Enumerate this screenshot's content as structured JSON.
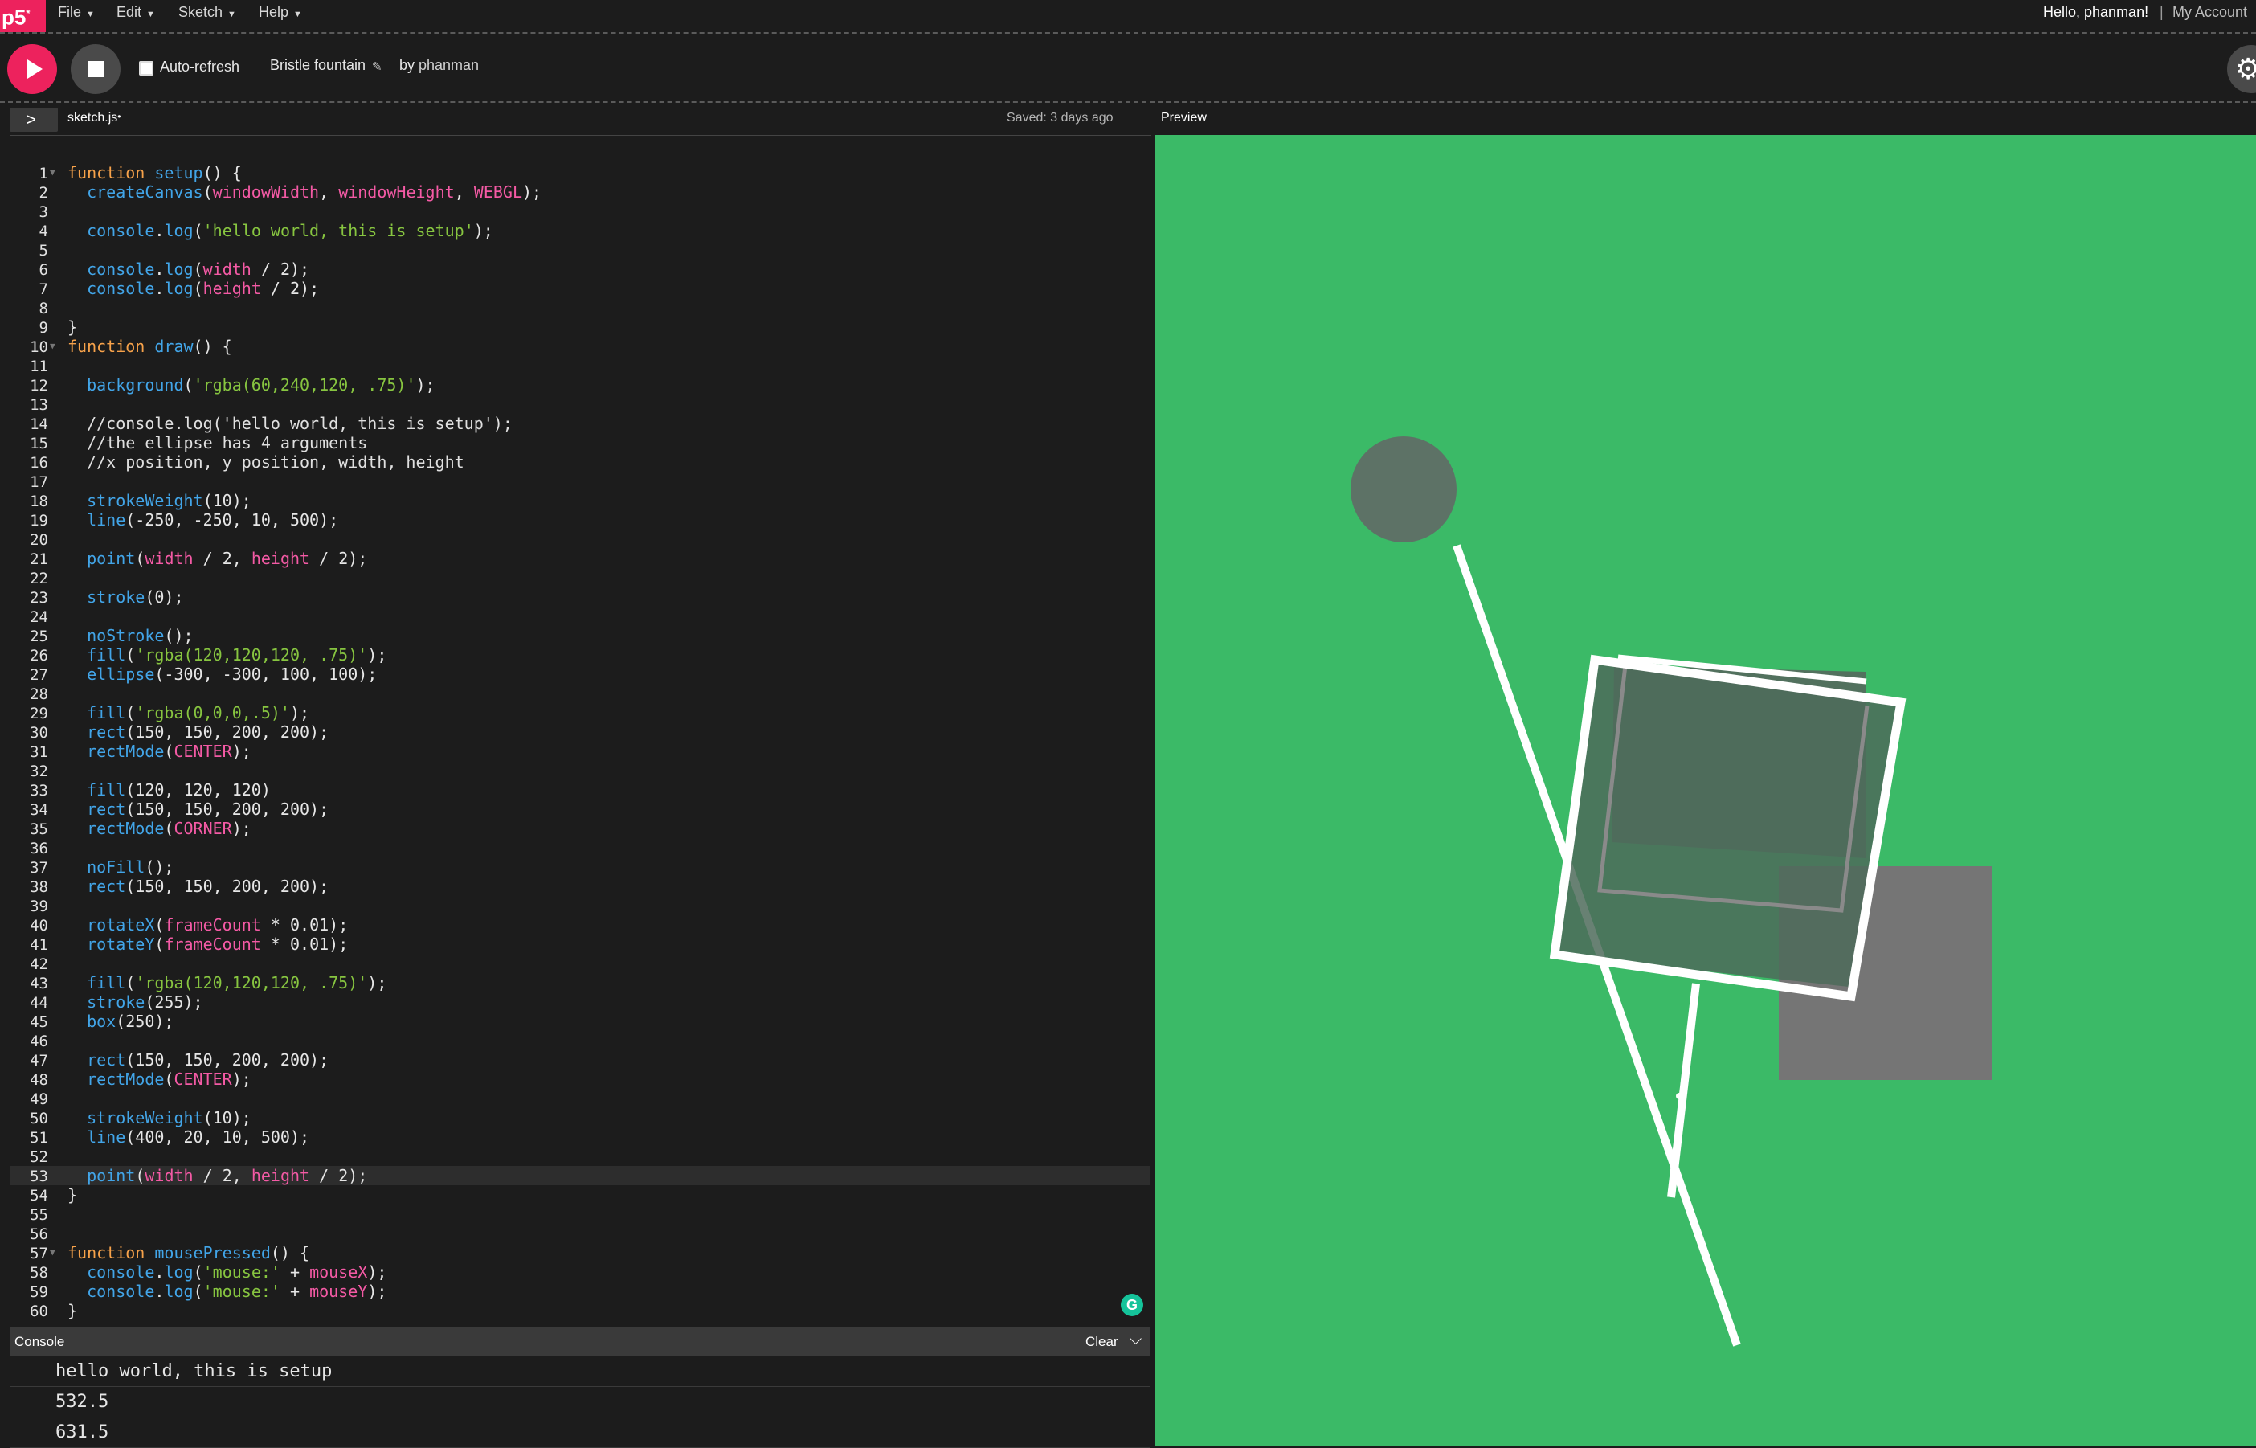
{
  "nav": {
    "logo": "p5",
    "logo_mark": "*",
    "menus": [
      {
        "label": "File"
      },
      {
        "label": "Edit"
      },
      {
        "label": "Sketch"
      },
      {
        "label": "Help"
      }
    ],
    "greeting": "Hello, phanman!",
    "separator": "|",
    "account": "My Account"
  },
  "toolbar": {
    "auto_refresh_label": "Auto-refresh",
    "auto_refresh_checked": false,
    "sketch_name": "Bristle fountain",
    "by_label": "by",
    "author": "phanman"
  },
  "editor": {
    "file_name": "sketch.js",
    "unsaved_mark": "•",
    "saved_status": "Saved: 3 days ago",
    "active_line": 53,
    "lines": [
      [],
      [
        [
          "k",
          "function "
        ],
        [
          "f",
          "setup"
        ],
        [
          "p",
          "() {"
        ]
      ],
      [
        [
          "p",
          "  "
        ],
        [
          "f",
          "createCanvas"
        ],
        [
          "p",
          "("
        ],
        [
          "v",
          "windowWidth"
        ],
        [
          "p",
          ", "
        ],
        [
          "v",
          "windowHeight"
        ],
        [
          "p",
          ", "
        ],
        [
          "v",
          "WEBGL"
        ],
        [
          "p",
          ");"
        ]
      ],
      [],
      [
        [
          "p",
          "  "
        ],
        [
          "f",
          "console"
        ],
        [
          "p",
          "."
        ],
        [
          "f",
          "log"
        ],
        [
          "p",
          "("
        ],
        [
          "s",
          "'hello world, this is setup'"
        ],
        [
          "p",
          ");"
        ]
      ],
      [],
      [
        [
          "p",
          "  "
        ],
        [
          "f",
          "console"
        ],
        [
          "p",
          "."
        ],
        [
          "f",
          "log"
        ],
        [
          "p",
          "("
        ],
        [
          "v",
          "width"
        ],
        [
          "p",
          " / 2);"
        ]
      ],
      [
        [
          "p",
          "  "
        ],
        [
          "f",
          "console"
        ],
        [
          "p",
          "."
        ],
        [
          "f",
          "log"
        ],
        [
          "p",
          "("
        ],
        [
          "v",
          "height"
        ],
        [
          "p",
          " / 2);"
        ]
      ],
      [],
      [
        [
          "p",
          "}"
        ]
      ],
      [
        [
          "k",
          "function "
        ],
        [
          "f",
          "draw"
        ],
        [
          "p",
          "() {"
        ]
      ],
      [],
      [
        [
          "p",
          "  "
        ],
        [
          "f",
          "background"
        ],
        [
          "p",
          "("
        ],
        [
          "s",
          "'rgba(60,240,120, .75)'"
        ],
        [
          "p",
          ");"
        ]
      ],
      [],
      [
        [
          "c",
          "  //console.log('hello world, this is setup');"
        ]
      ],
      [
        [
          "c",
          "  //the ellipse has 4 arguments"
        ]
      ],
      [
        [
          "c",
          "  //x position, y position, width, height"
        ]
      ],
      [],
      [
        [
          "p",
          "  "
        ],
        [
          "f",
          "strokeWeight"
        ],
        [
          "p",
          "(10);"
        ]
      ],
      [
        [
          "p",
          "  "
        ],
        [
          "f",
          "line"
        ],
        [
          "p",
          "(-250, -250, 10, 500);"
        ]
      ],
      [],
      [
        [
          "p",
          "  "
        ],
        [
          "f",
          "point"
        ],
        [
          "p",
          "("
        ],
        [
          "v",
          "width"
        ],
        [
          "p",
          " / 2, "
        ],
        [
          "v",
          "height"
        ],
        [
          "p",
          " / 2);"
        ]
      ],
      [],
      [
        [
          "p",
          "  "
        ],
        [
          "f",
          "stroke"
        ],
        [
          "p",
          "(0);"
        ]
      ],
      [],
      [
        [
          "p",
          "  "
        ],
        [
          "f",
          "noStroke"
        ],
        [
          "p",
          "();"
        ]
      ],
      [
        [
          "p",
          "  "
        ],
        [
          "f",
          "fill"
        ],
        [
          "p",
          "("
        ],
        [
          "s",
          "'rgba(120,120,120, .75)'"
        ],
        [
          "p",
          ");"
        ]
      ],
      [
        [
          "p",
          "  "
        ],
        [
          "f",
          "ellipse"
        ],
        [
          "p",
          "(-300, -300, 100, 100);"
        ]
      ],
      [],
      [
        [
          "p",
          "  "
        ],
        [
          "f",
          "fill"
        ],
        [
          "p",
          "("
        ],
        [
          "s",
          "'rgba(0,0,0,.5)'"
        ],
        [
          "p",
          ");"
        ]
      ],
      [
        [
          "p",
          "  "
        ],
        [
          "f",
          "rect"
        ],
        [
          "p",
          "(150, 150, 200, 200);"
        ]
      ],
      [
        [
          "p",
          "  "
        ],
        [
          "f",
          "rectMode"
        ],
        [
          "p",
          "("
        ],
        [
          "v",
          "CENTER"
        ],
        [
          "p",
          ");"
        ]
      ],
      [],
      [
        [
          "p",
          "  "
        ],
        [
          "f",
          "fill"
        ],
        [
          "p",
          "(120, 120, 120)"
        ]
      ],
      [
        [
          "p",
          "  "
        ],
        [
          "f",
          "rect"
        ],
        [
          "p",
          "(150, 150, 200, 200);"
        ]
      ],
      [
        [
          "p",
          "  "
        ],
        [
          "f",
          "rectMode"
        ],
        [
          "p",
          "("
        ],
        [
          "v",
          "CORNER"
        ],
        [
          "p",
          ");"
        ]
      ],
      [],
      [
        [
          "p",
          "  "
        ],
        [
          "f",
          "noFill"
        ],
        [
          "p",
          "();"
        ]
      ],
      [
        [
          "p",
          "  "
        ],
        [
          "f",
          "rect"
        ],
        [
          "p",
          "(150, 150, 200, 200);"
        ]
      ],
      [],
      [
        [
          "p",
          "  "
        ],
        [
          "f",
          "rotateX"
        ],
        [
          "p",
          "("
        ],
        [
          "v",
          "frameCount"
        ],
        [
          "p",
          " * 0.01);"
        ]
      ],
      [
        [
          "p",
          "  "
        ],
        [
          "f",
          "rotateY"
        ],
        [
          "p",
          "("
        ],
        [
          "v",
          "frameCount"
        ],
        [
          "p",
          " * 0.01);"
        ]
      ],
      [],
      [
        [
          "p",
          "  "
        ],
        [
          "f",
          "fill"
        ],
        [
          "p",
          "("
        ],
        [
          "s",
          "'rgba(120,120,120, .75)'"
        ],
        [
          "p",
          ");"
        ]
      ],
      [
        [
          "p",
          "  "
        ],
        [
          "f",
          "stroke"
        ],
        [
          "p",
          "(255);"
        ]
      ],
      [
        [
          "p",
          "  "
        ],
        [
          "f",
          "box"
        ],
        [
          "p",
          "(250);"
        ]
      ],
      [],
      [
        [
          "p",
          "  "
        ],
        [
          "f",
          "rect"
        ],
        [
          "p",
          "(150, 150, 200, 200);"
        ]
      ],
      [
        [
          "p",
          "  "
        ],
        [
          "f",
          "rectMode"
        ],
        [
          "p",
          "("
        ],
        [
          "v",
          "CENTER"
        ],
        [
          "p",
          ");"
        ]
      ],
      [],
      [
        [
          "p",
          "  "
        ],
        [
          "f",
          "strokeWeight"
        ],
        [
          "p",
          "(10);"
        ]
      ],
      [
        [
          "p",
          "  "
        ],
        [
          "f",
          "line"
        ],
        [
          "p",
          "(400, 20, 10, 500);"
        ]
      ],
      [],
      [
        [
          "p",
          "  "
        ],
        [
          "f",
          "point"
        ],
        [
          "p",
          "("
        ],
        [
          "v",
          "width"
        ],
        [
          "p",
          " / 2, "
        ],
        [
          "v",
          "height"
        ],
        [
          "p",
          " / 2);"
        ]
      ],
      [
        [
          "p",
          "}"
        ]
      ],
      [],
      [],
      [
        [
          "k",
          "function "
        ],
        [
          "f",
          "mousePressed"
        ],
        [
          "p",
          "() {"
        ]
      ],
      [
        [
          "p",
          "  "
        ],
        [
          "f",
          "console"
        ],
        [
          "p",
          "."
        ],
        [
          "f",
          "log"
        ],
        [
          "p",
          "("
        ],
        [
          "s",
          "'mouse:'"
        ],
        [
          "p",
          " + "
        ],
        [
          "v",
          "mouseX"
        ],
        [
          "p",
          ");"
        ]
      ],
      [
        [
          "p",
          "  "
        ],
        [
          "f",
          "console"
        ],
        [
          "p",
          "."
        ],
        [
          "f",
          "log"
        ],
        [
          "p",
          "("
        ],
        [
          "s",
          "'mouse:'"
        ],
        [
          "p",
          " + "
        ],
        [
          "v",
          "mouseY"
        ],
        [
          "p",
          ");"
        ]
      ],
      [
        [
          "p",
          "}"
        ]
      ]
    ],
    "fold_lines": [
      1,
      10,
      57
    ]
  },
  "console": {
    "title": "Console",
    "clear_label": "Clear",
    "messages": [
      "hello world, this is setup",
      "532.5",
      "631.5"
    ]
  },
  "preview": {
    "label": "Preview",
    "background": "#3bba67"
  },
  "colors": {
    "accent": "#ed225d",
    "keyword": "#f7a24a",
    "function": "#42a5e8",
    "string": "#87c540",
    "variable": "#f45aa5"
  }
}
